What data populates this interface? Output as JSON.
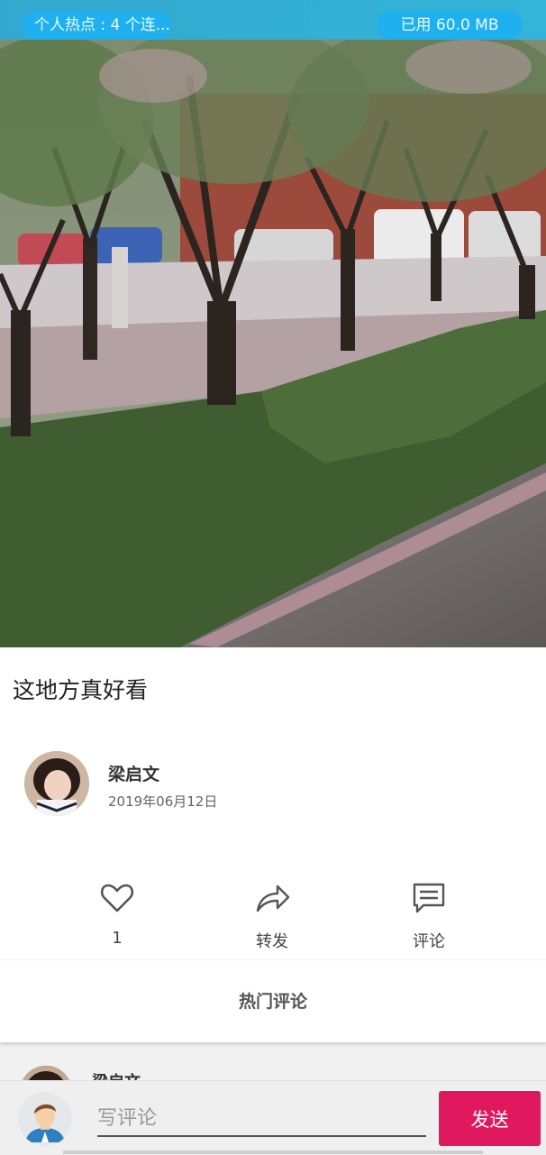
{
  "status_bar": {
    "hotspot_text": "个人热点 : 4 个连...",
    "data_used_text": "已用 60.0 MB"
  },
  "post": {
    "title": "这地方真好看",
    "author_name": "梁启文",
    "date": "2019年06月12日"
  },
  "actions": {
    "like_count": "1",
    "share_label": "转发",
    "comment_label": "评论"
  },
  "hot_comments_label": "热门评论",
  "comment_preview": {
    "author_name": "梁启文"
  },
  "composer": {
    "placeholder": "写评论",
    "send_label": "发送"
  },
  "colors": {
    "status_bar": "#33b4d9",
    "pill": "#1fb0f0",
    "send_button": "#e0185e"
  }
}
